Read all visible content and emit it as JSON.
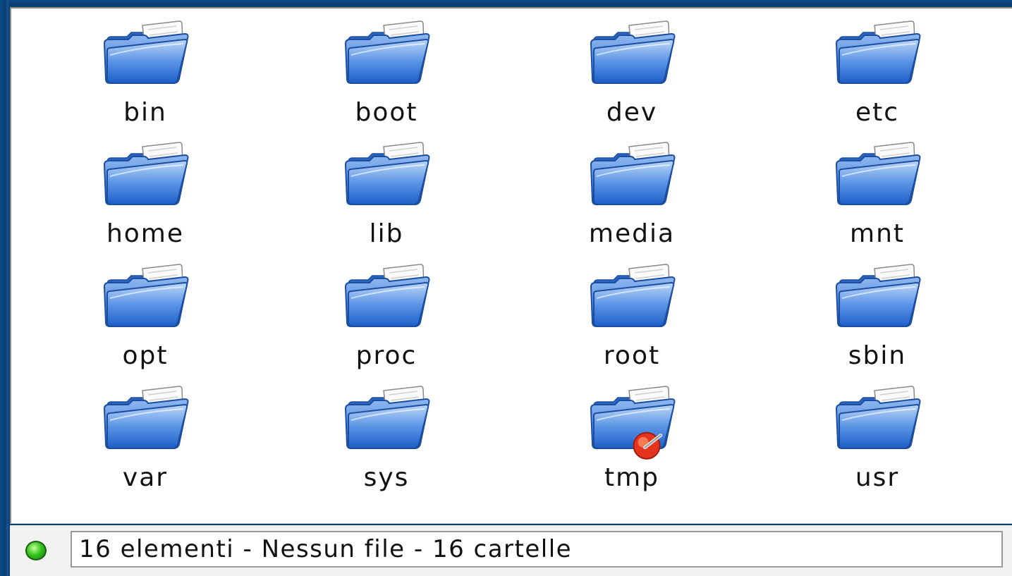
{
  "folders": [
    {
      "name": "bin",
      "icon": "folder-icon"
    },
    {
      "name": "boot",
      "icon": "folder-icon"
    },
    {
      "name": "dev",
      "icon": "folder-icon"
    },
    {
      "name": "etc",
      "icon": "folder-icon"
    },
    {
      "name": "home",
      "icon": "folder-icon"
    },
    {
      "name": "lib",
      "icon": "folder-icon"
    },
    {
      "name": "media",
      "icon": "folder-icon"
    },
    {
      "name": "mnt",
      "icon": "folder-icon"
    },
    {
      "name": "opt",
      "icon": "folder-icon"
    },
    {
      "name": "proc",
      "icon": "folder-icon"
    },
    {
      "name": "root",
      "icon": "folder-icon"
    },
    {
      "name": "sbin",
      "icon": "folder-icon"
    },
    {
      "name": "var",
      "icon": "folder-icon"
    },
    {
      "name": "sys",
      "icon": "folder-icon"
    },
    {
      "name": "tmp",
      "icon": "folder-temporary-icon"
    },
    {
      "name": "usr",
      "icon": "folder-icon"
    }
  ],
  "statusbar": {
    "text": "16 elementi - Nessun file - 16 cartelle",
    "indicator_color": "#35c51f"
  },
  "colors": {
    "window_frame": "#0a3f74",
    "folder_blue": "#3a7fe0",
    "view_background": "#ffffff"
  }
}
